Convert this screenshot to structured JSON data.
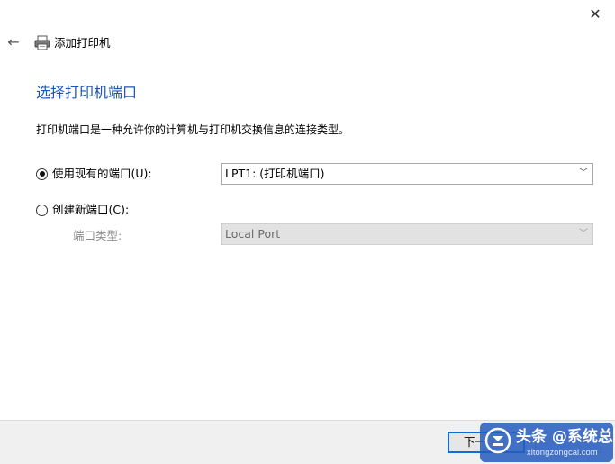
{
  "window": {
    "title": "添加打印机",
    "close_icon": "close-icon",
    "back_icon": "back-arrow-icon",
    "printer_icon": "printer-icon"
  },
  "page": {
    "heading": "选择打印机端口",
    "description": "打印机端口是一种允许你的计算机与打印机交换信息的连接类型。"
  },
  "options": {
    "use_existing": {
      "label": "使用现有的端口(U):",
      "checked": true,
      "selected_value": "LPT1: (打印机端口)"
    },
    "create_new": {
      "label": "创建新端口(C):",
      "checked": false,
      "port_type_label": "端口类型:",
      "port_type_value": "Local Port"
    }
  },
  "footer": {
    "next_label": "下一",
    "cancel_label": ""
  },
  "watermark": {
    "text": "头条 @系统总裁",
    "subtext": "xitongzongcai.com"
  },
  "colors": {
    "heading": "#1a56b4",
    "focus_border": "#0f6bd6",
    "footer_bg": "#f0f0f0",
    "disabled_bg": "#e2e2e2"
  }
}
